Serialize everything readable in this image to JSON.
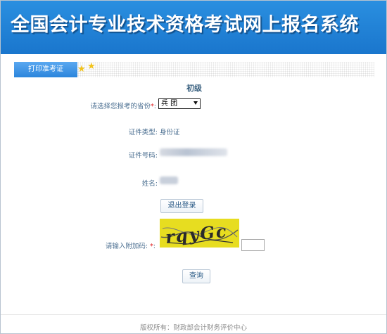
{
  "header": {
    "title": "全国会计专业技术资格考试网上报名系统"
  },
  "tab": {
    "label": "打印准考证"
  },
  "exam": {
    "level": "初级"
  },
  "form": {
    "province_label": "请选择您报考的省份",
    "required_mark": "*",
    "colon": ":",
    "province_value": "兵 团",
    "id_type_label": "证件类型:",
    "id_type_value": "身份证",
    "id_number_label": "证件号码:",
    "name_label": "姓名:",
    "captcha_label": "请输入附加码:",
    "captcha_text": "rqyGc"
  },
  "buttons": {
    "logout": "退出登录",
    "query": "查询"
  },
  "footer": {
    "text": "版权所有：财政部会计财务评价中心"
  },
  "colors": {
    "banner": "#1a76cd",
    "tab": "#2b85dc",
    "captcha_bg": "#e7dd20",
    "required": "#e0191b"
  }
}
